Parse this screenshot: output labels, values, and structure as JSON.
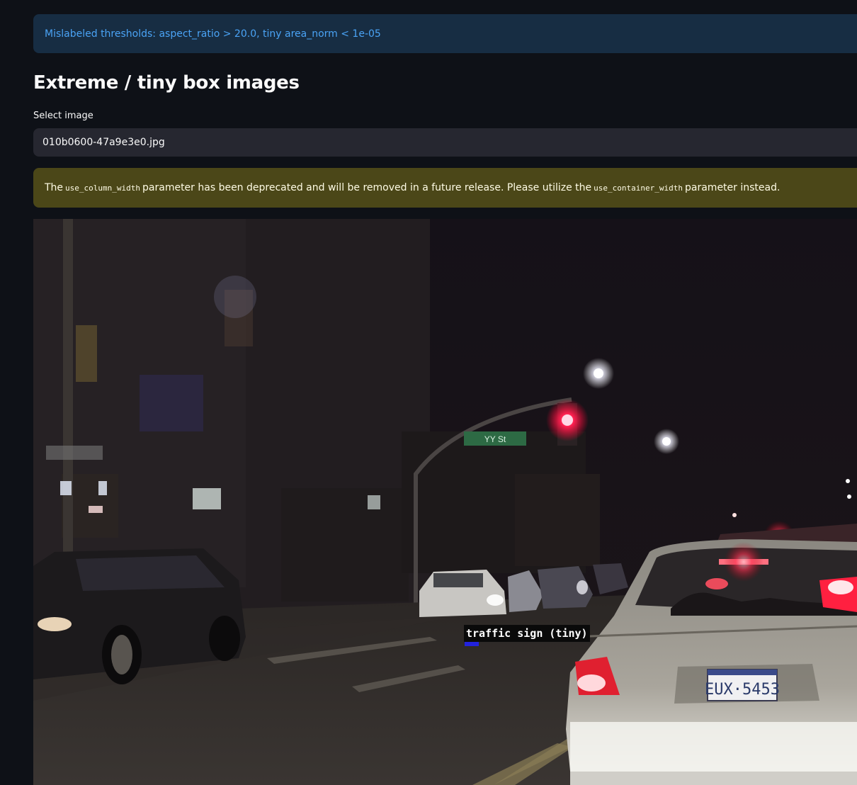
{
  "info_banner": {
    "text": "Mislabeled thresholds: aspect_ratio > 20.0, tiny area_norm < 1e-05"
  },
  "section": {
    "title": "Extreme / tiny box images"
  },
  "image_select": {
    "label": "Select image",
    "value": "010b0600-47a9e3e0.jpg"
  },
  "warning": {
    "part1": "The",
    "code1": "use_column_width",
    "part2": "parameter has been deprecated and will be removed in a future release. Please utilize the",
    "code2": "use_container_width",
    "part3": "parameter instead."
  },
  "photo": {
    "detection_label": "traffic sign (tiny)",
    "street_sign_text": "YY St",
    "plate_text": "EUX·5453"
  },
  "colors": {
    "background": "#0e1117",
    "info_bg": "#172d43",
    "info_text": "#4aa3f5",
    "warning_bg": "#4b4718",
    "select_bg": "#262730",
    "box_color": "#2222dd"
  }
}
